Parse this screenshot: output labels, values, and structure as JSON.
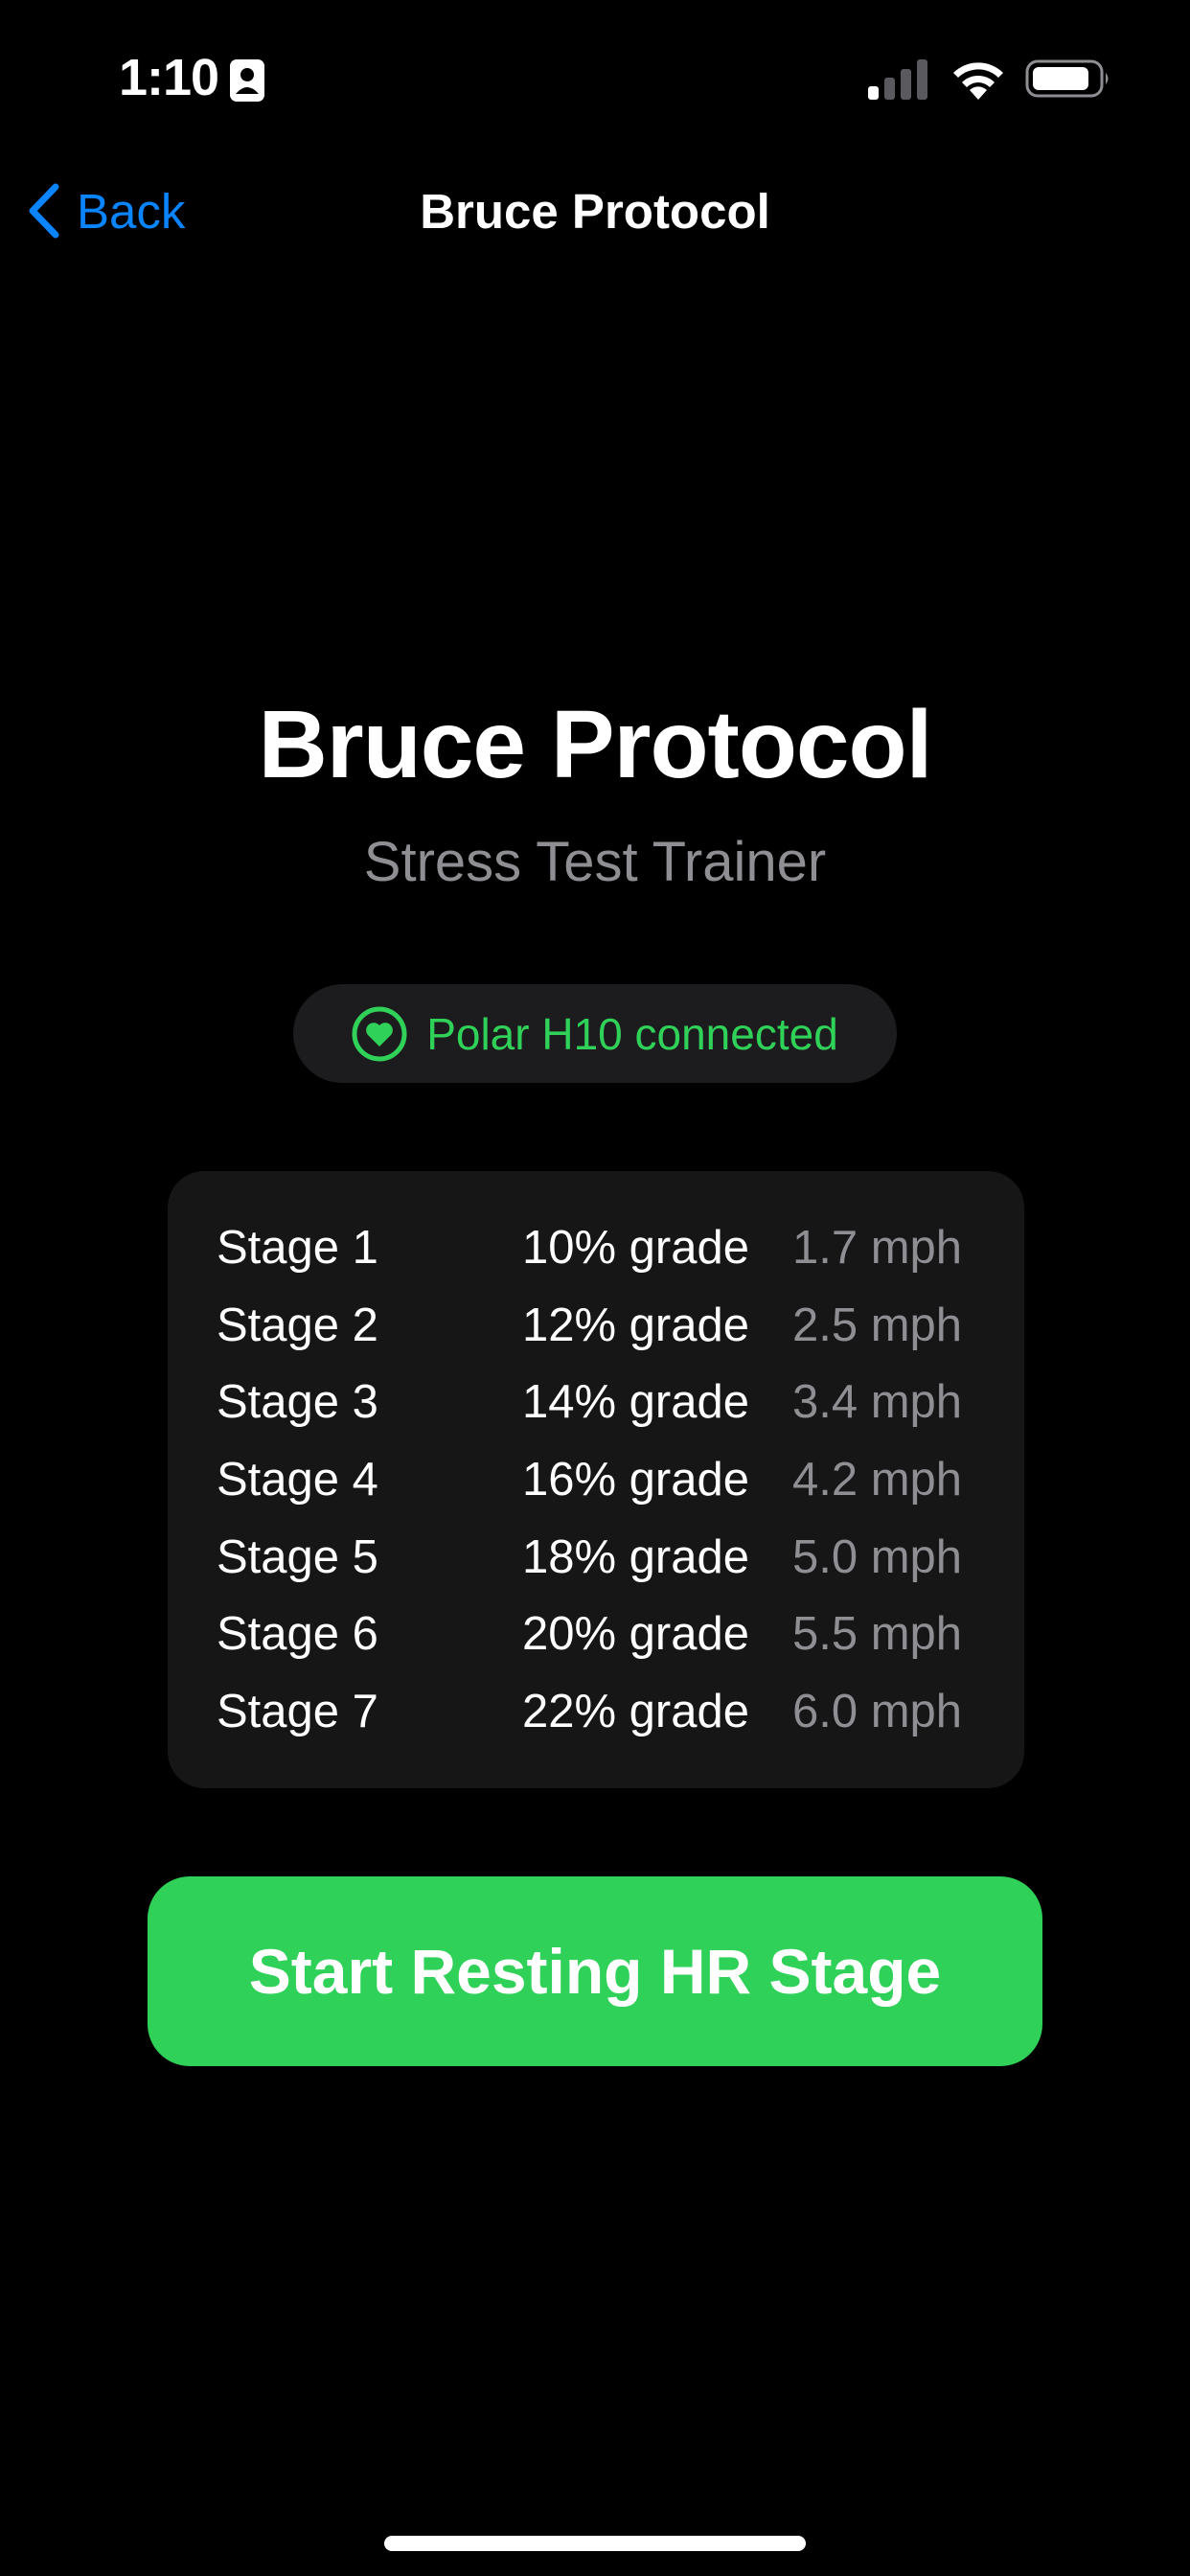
{
  "status_bar": {
    "time": "1:10",
    "icons": [
      "person-badge-icon",
      "cellular-signal-icon",
      "wifi-icon",
      "battery-icon"
    ]
  },
  "nav": {
    "back_label": "Back",
    "title": "Bruce Protocol"
  },
  "header": {
    "title": "Bruce Protocol",
    "subtitle": "Stress Test Trainer"
  },
  "connection": {
    "icon": "heart-icon",
    "text": "Polar H10 connected",
    "color": "#30d158"
  },
  "stages": [
    {
      "name": "Stage 1",
      "grade": "10% grade",
      "speed": "1.7 mph"
    },
    {
      "name": "Stage 2",
      "grade": "12% grade",
      "speed": "2.5 mph"
    },
    {
      "name": "Stage 3",
      "grade": "14% grade",
      "speed": "3.4 mph"
    },
    {
      "name": "Stage 4",
      "grade": "16% grade",
      "speed": "4.2 mph"
    },
    {
      "name": "Stage 5",
      "grade": "18% grade",
      "speed": "5.0 mph"
    },
    {
      "name": "Stage 6",
      "grade": "20% grade",
      "speed": "5.5 mph"
    },
    {
      "name": "Stage 7",
      "grade": "22% grade",
      "speed": "6.0 mph"
    }
  ],
  "start_button": {
    "label": "Start Resting HR Stage",
    "color": "#30d158"
  },
  "colors": {
    "background": "#000000",
    "accent": "#0a84ff",
    "secondary_text": "#8e8e93"
  }
}
